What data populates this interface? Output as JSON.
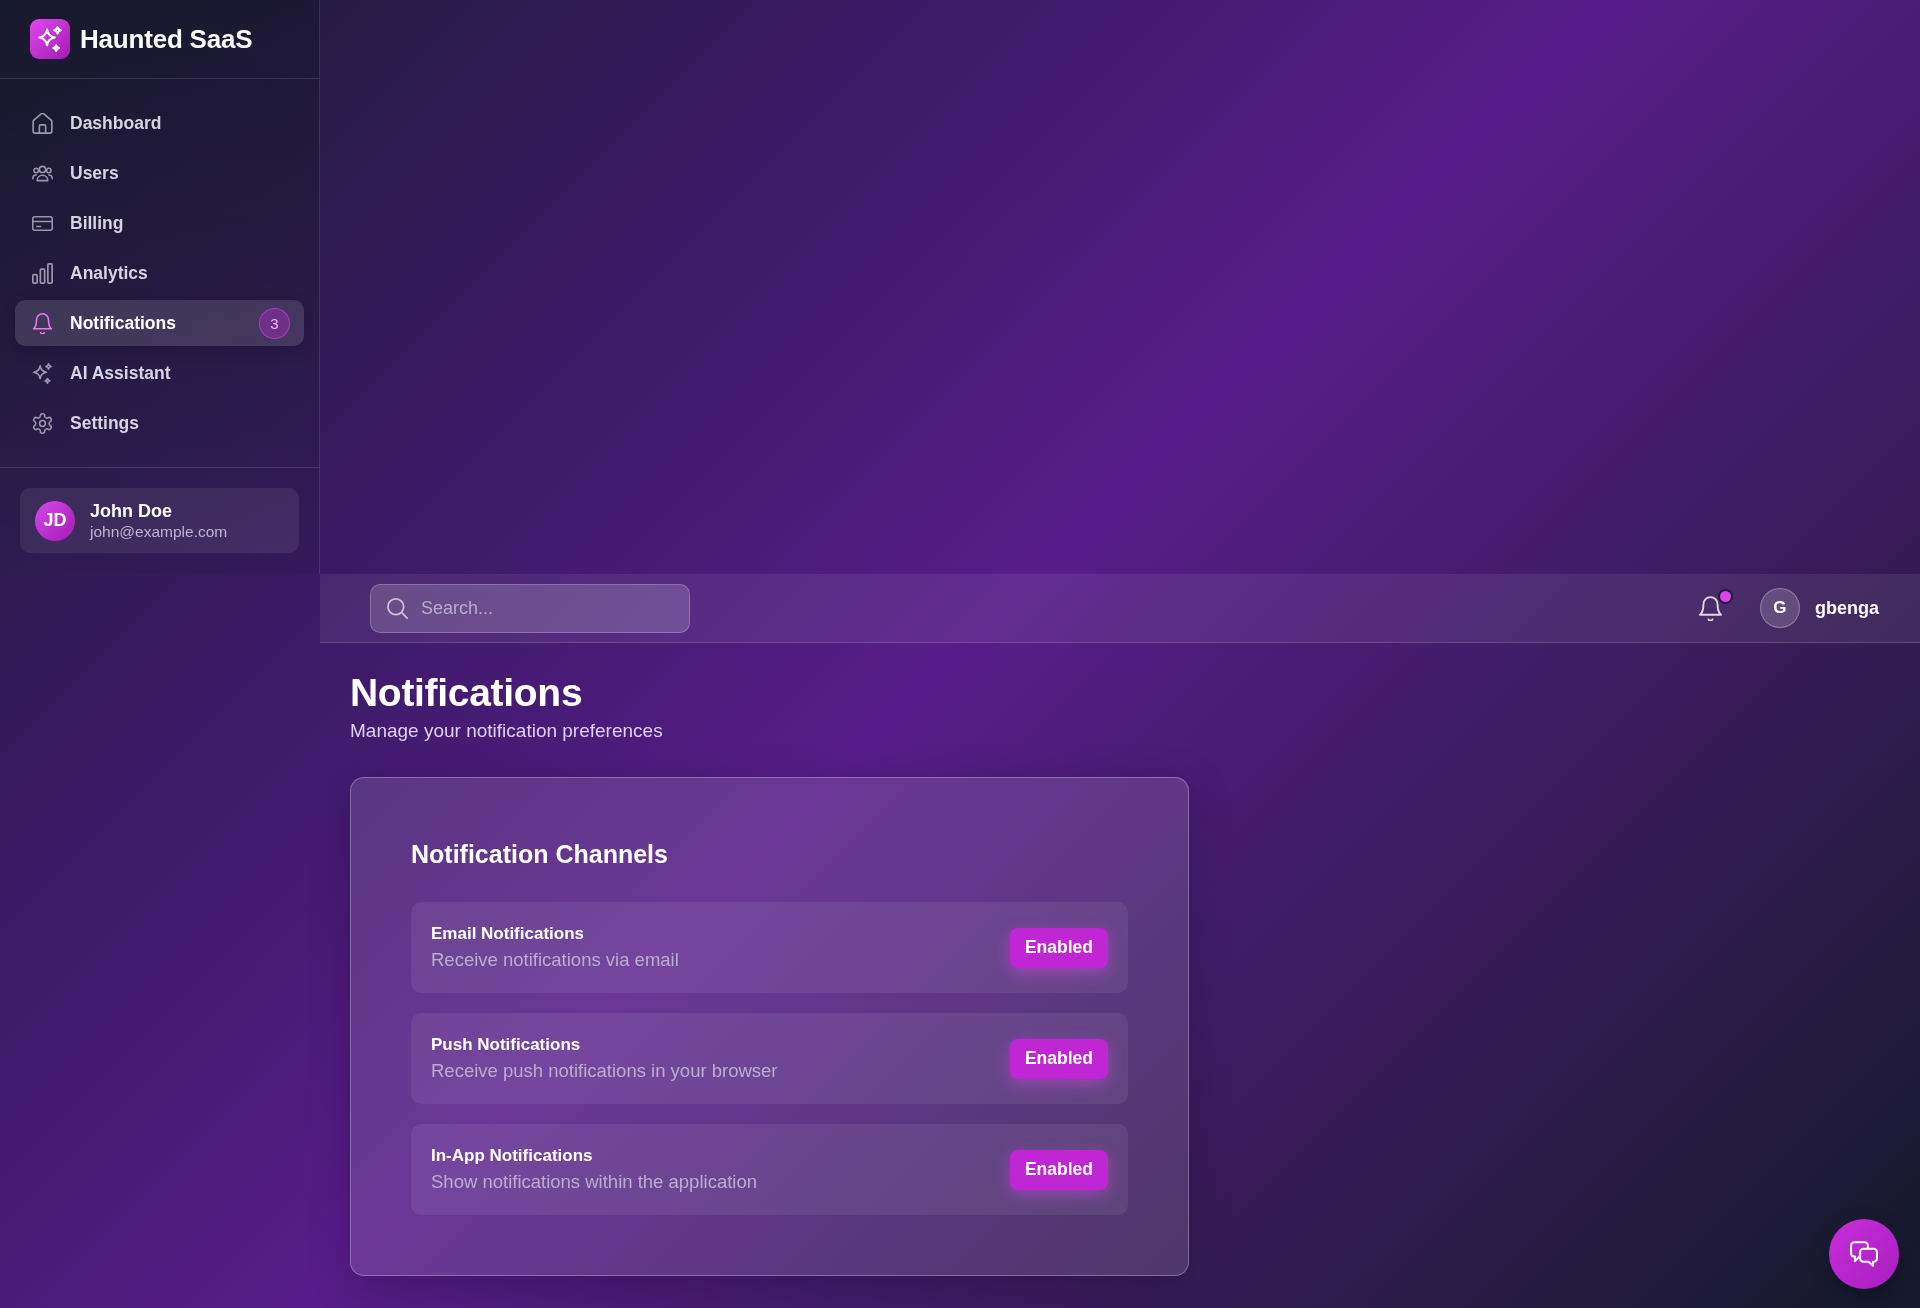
{
  "sidebar": {
    "brand": "Haunted SaaS",
    "items": [
      {
        "label": "Dashboard",
        "selected": false
      },
      {
        "label": "Users",
        "selected": false
      },
      {
        "label": "Billing",
        "selected": false
      },
      {
        "label": "Analytics",
        "selected": false
      },
      {
        "label": "Notifications",
        "selected": true,
        "badge": "3"
      },
      {
        "label": "AI Assistant",
        "selected": false
      },
      {
        "label": "Settings",
        "selected": false
      }
    ],
    "user": {
      "initials": "JD",
      "name": "John Doe",
      "email": "john@example.com"
    }
  },
  "top_bar": {
    "search": {
      "placeholder": "Search..."
    },
    "bell": {
      "unread": true
    },
    "user": {
      "initials": "G",
      "name": "gbenga"
    }
  },
  "page": {
    "title": "Notifications",
    "subtitle": "Manage your notification preferences"
  },
  "channels_card": {
    "title": "Notification Channels",
    "channels": [
      {
        "name": "Email Notifications",
        "description": "Receive notifications via email",
        "enabled": true,
        "label": "Enabled"
      },
      {
        "name": "Push Notifications",
        "description": "Receive push notifications in your browser",
        "enabled": true,
        "label": "Enabled"
      },
      {
        "name": "In-App Notifications",
        "description": "Show notifications within the application",
        "enabled": true,
        "label": "Enabled"
      }
    ]
  }
}
